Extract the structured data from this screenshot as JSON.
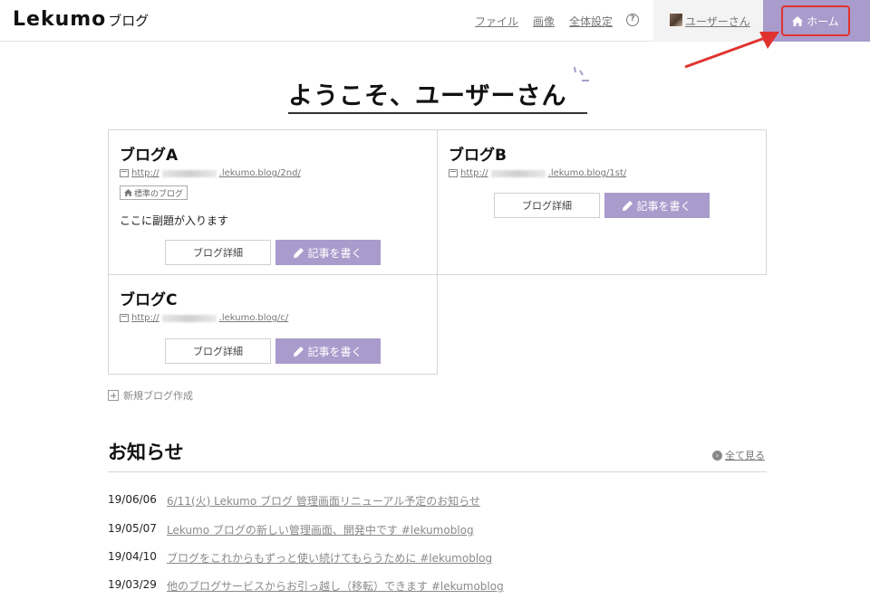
{
  "header": {
    "logo_main": "Lekumo",
    "logo_sub": "ブログ",
    "nav": [
      {
        "label": "ファイル"
      },
      {
        "label": "画像"
      },
      {
        "label": "全体設定"
      }
    ],
    "help_symbol": "?",
    "user_name": "ユーザーさん",
    "home_label": "ホーム"
  },
  "welcome": {
    "heading": "ようこそ、ユーザーさん"
  },
  "blogs": [
    {
      "title": "ブログA",
      "url_prefix": "http://",
      "url_suffix": ".lekumo.blog/2nd/",
      "badge": "標準のブログ",
      "subtitle": "ここに副題が入ります",
      "detail_label": "ブログ詳細",
      "write_label": "記事を書く"
    },
    {
      "title": "ブログB",
      "url_prefix": "http://",
      "url_suffix": ".lekumo.blog/1st/",
      "detail_label": "ブログ詳細",
      "write_label": "記事を書く"
    },
    {
      "title": "ブログC",
      "url_prefix": "http://",
      "url_suffix": ".lekumo.blog/c/",
      "detail_label": "ブログ詳細",
      "write_label": "記事を書く"
    }
  ],
  "new_blog_label": "新規ブログ作成",
  "news": {
    "title": "お知らせ",
    "see_all_label": "全て見る",
    "items": [
      {
        "date": "19/06/06",
        "text": "6/11(火) Lekumo ブログ 管理画面リニューアル予定のお知らせ"
      },
      {
        "date": "19/05/07",
        "text": "Lekumo ブログの新しい管理画面、開発中です #lekumoblog"
      },
      {
        "date": "19/04/10",
        "text": "ブログをこれからもずっと使い続けてもらうために #lekumoblog"
      },
      {
        "date": "19/03/29",
        "text": "他のブログサービスからお引っ越し（移転）できます #lekumoblog"
      }
    ]
  },
  "colors": {
    "accent": "#a99bcb",
    "annotation": "#e0332f",
    "link_gray": "#777777"
  },
  "icons": [
    "home-icon",
    "help-icon",
    "avatar",
    "pencil-icon",
    "window-icon",
    "plus-icon",
    "arrow-circle-icon"
  ]
}
